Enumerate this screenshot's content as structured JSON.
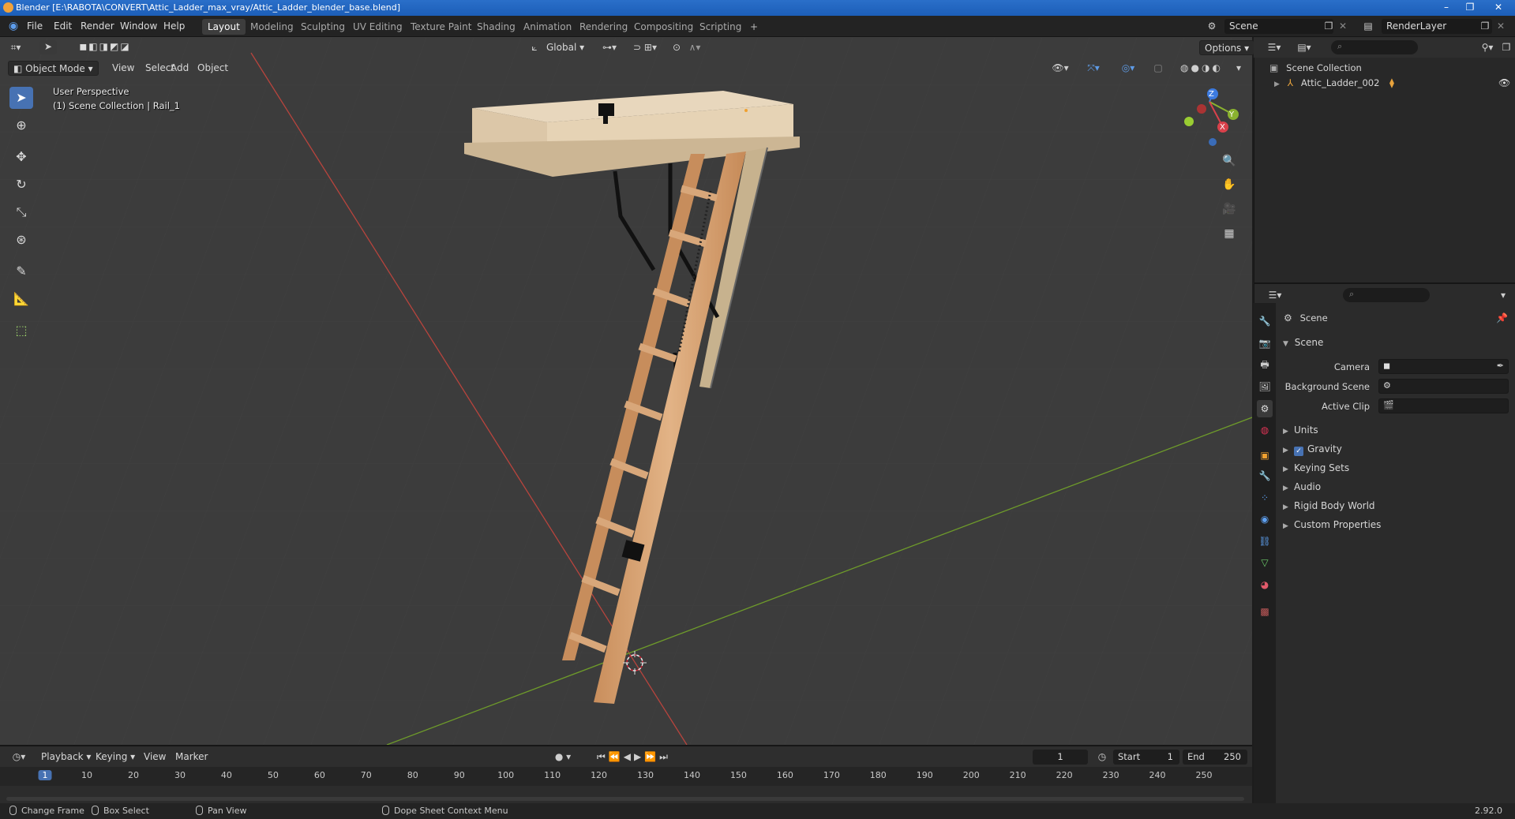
{
  "window": {
    "title": "Blender [E:\\RABOTA\\CONVERT\\Attic_Ladder_max_vray/Attic_Ladder_blender_base.blend]",
    "buttons": [
      "–",
      "❐",
      "✕"
    ]
  },
  "menubar": {
    "menus": [
      "File",
      "Edit",
      "Render",
      "Window",
      "Help"
    ],
    "workspaces": [
      "Layout",
      "Modeling",
      "Sculpting",
      "UV Editing",
      "Texture Paint",
      "Shading",
      "Animation",
      "Rendering",
      "Compositing",
      "Scripting"
    ],
    "active_workspace": "Layout",
    "add_tab": "+",
    "scene": "Scene",
    "view_layer": "RenderLayer"
  },
  "viewport": {
    "mode": "Object Mode",
    "menus": [
      "View",
      "Select",
      "Add",
      "Object"
    ],
    "orientation": "Global",
    "options": "Options",
    "overlay_line1": "User Perspective",
    "overlay_line2": "(1) Scene Collection | Rail_1",
    "gizmo_axes": [
      "Z",
      "Y",
      "X"
    ]
  },
  "outliner": {
    "root": "Scene Collection",
    "items": [
      {
        "name": "Attic_Ladder_002"
      }
    ]
  },
  "properties": {
    "context": "Scene",
    "panel": "Scene",
    "fields": [
      {
        "label": "Camera"
      },
      {
        "label": "Background Scene"
      },
      {
        "label": "Active Clip"
      }
    ],
    "subpanels": [
      "Units",
      "Gravity",
      "Keying Sets",
      "Audio",
      "Rigid Body World",
      "Custom Properties"
    ],
    "gravity_checked": true
  },
  "timeline": {
    "menus": [
      "Playback",
      "Keying",
      "View",
      "Marker"
    ],
    "current_frame": "1",
    "start_label": "Start",
    "start": "1",
    "end_label": "End",
    "end": "250",
    "ticks": [
      "1",
      "10",
      "20",
      "30",
      "40",
      "50",
      "60",
      "70",
      "80",
      "90",
      "100",
      "110",
      "120",
      "130",
      "140",
      "150",
      "160",
      "170",
      "180",
      "190",
      "200",
      "210",
      "220",
      "230",
      "240",
      "250"
    ]
  },
  "statusbar": {
    "items": [
      "Change Frame",
      "Box Select",
      "Pan View",
      "Dope Sheet Context Menu"
    ],
    "version": "2.92.0"
  },
  "colors": {
    "accent": "#4772b3",
    "x_axis": "#b8443d",
    "y_axis": "#6e9b2a",
    "wood": "#d8a77a"
  }
}
